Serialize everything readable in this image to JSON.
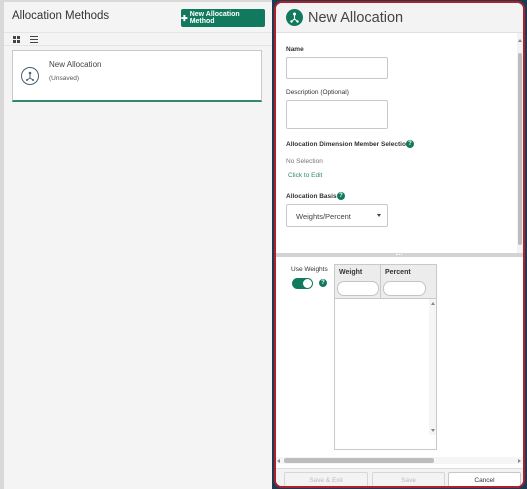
{
  "left": {
    "title": "Allocation Methods",
    "new_button_label": "New Allocation Method",
    "items": [
      {
        "title": "New Allocation",
        "subtitle": "(Unsaved)"
      }
    ]
  },
  "editor": {
    "title": "New Allocation",
    "name_label": "Name",
    "name_value": "",
    "description_label": "Description (Optional)",
    "description_value": "",
    "dimension_label": "Allocation Dimension Member Selection",
    "dimension_status": "No Selection",
    "dimension_link": "Click to Edit",
    "basis_label": "Allocation Basis",
    "basis_value": "Weights/Percent",
    "help_glyph": "?",
    "use_weights_label": "Use Weights",
    "use_weights_on": true,
    "grid_columns": [
      "Weight",
      "Percent"
    ]
  },
  "footer": {
    "save_exit": "Save & Exit",
    "save": "Save",
    "cancel": "Cancel"
  },
  "colors": {
    "accent": "#117a5e",
    "panel_border": "#b0202a",
    "sidebar_bg": "#1e3a52"
  }
}
